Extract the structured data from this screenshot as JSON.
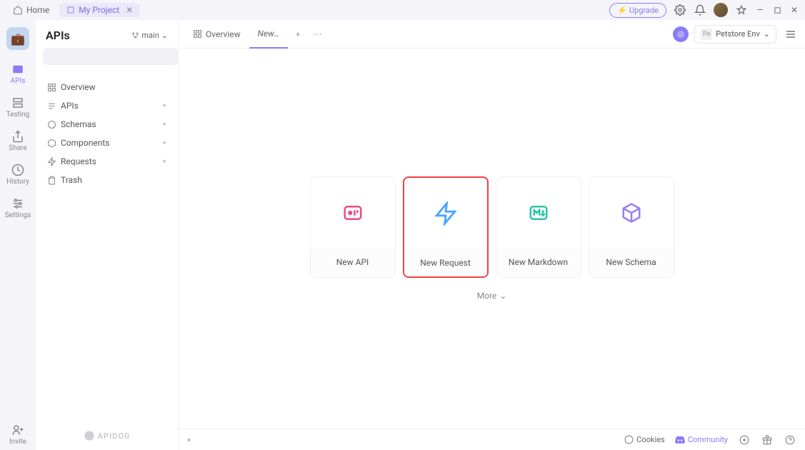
{
  "titlebar": {
    "home_label": "Home",
    "project_label": "My Project",
    "upgrade": "Upgrade"
  },
  "leftnav": {
    "items": [
      "APIs",
      "Testing",
      "Share",
      "History",
      "Settings"
    ],
    "invite_label": "Invite"
  },
  "sidebar": {
    "title": "APIs",
    "branch": "main",
    "search_placeholder": "",
    "tree": [
      "Overview",
      "APIs",
      "Schemas",
      "Components",
      "Requests",
      "Trash"
    ],
    "brand": "APIDOG"
  },
  "tabs": {
    "overview_label": "Overview",
    "active_label": "New…",
    "env_label": "Petstore Env"
  },
  "cards": {
    "new_api": "New API",
    "new_request": "New Request",
    "new_markdown": "New Markdown",
    "new_schema": "New Schema",
    "more": "More"
  },
  "footer": {
    "cookies": "Cookies",
    "community": "Community"
  }
}
